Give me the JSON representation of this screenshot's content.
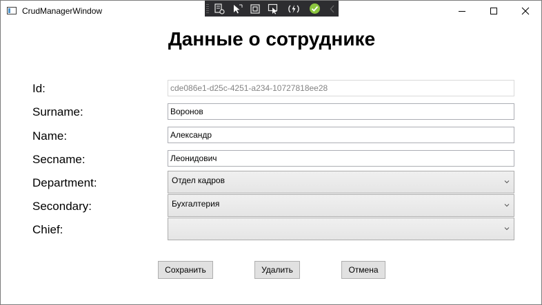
{
  "window": {
    "title": "CrudManagerWindow"
  },
  "debug_toolbar": {
    "icons": [
      "live-visual-tree-icon",
      "select-element-icon",
      "display-layout-adorners-icon",
      "track-focused-element-icon",
      "hot-reload-icon",
      "check-status-icon",
      "collapse-chevron-icon"
    ]
  },
  "form": {
    "title": "Данные о сотруднике",
    "fields": [
      {
        "label": "Id:",
        "value": "cde086e1-d25c-4251-a234-10727818ee28"
      },
      {
        "label": "Surname:",
        "value": "Воронов"
      },
      {
        "label": "Name:",
        "value": "Александр"
      },
      {
        "label": "Secname:",
        "value": "Леонидович"
      },
      {
        "label": "Department:",
        "value": "Отдел кадров"
      },
      {
        "label": "Secondary:",
        "value": "Бухгалтерия"
      },
      {
        "label": "Chief:",
        "value": ""
      }
    ]
  },
  "buttons": {
    "save": "Сохранить",
    "delete": "Удалить",
    "cancel": "Отмена"
  }
}
